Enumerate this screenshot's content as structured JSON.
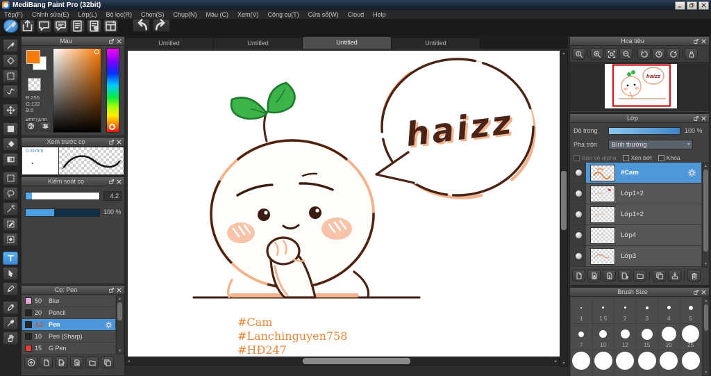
{
  "window": {
    "title": "MediBang Paint Pro (32bit)",
    "controls": [
      {
        "name": "minimize-button",
        "icon": "min"
      },
      {
        "name": "restore-button",
        "icon": "restore"
      },
      {
        "name": "close-button",
        "icon": "closewin"
      }
    ]
  },
  "menu": {
    "items": [
      "Tệp(F)",
      "Chỉnh sửa(E)",
      "Lớp(L)",
      "Bộ lọc(R)",
      "Chọn(S)",
      "Chụp(N)",
      "Màu (C)",
      "Xem(V)",
      "Công cụ(T)",
      "Cửa sổ(W)",
      "Cloud",
      "Help"
    ]
  },
  "toolbar": {
    "main": [
      {
        "name": "paint-mode-button",
        "icon": "brush",
        "active": true
      },
      {
        "name": "share-button",
        "icon": "share"
      },
      {
        "name": "comment-button",
        "icon": "chat"
      },
      {
        "name": "comment-list-button",
        "icon": "chat2"
      },
      {
        "name": "document-button",
        "icon": "doc"
      },
      {
        "name": "document-settings-button",
        "icon": "docgear"
      },
      {
        "name": "material-panel-button",
        "icon": "grid"
      }
    ],
    "history": [
      {
        "name": "undo-button",
        "icon": "undo"
      },
      {
        "name": "redo-button",
        "icon": "redo"
      }
    ]
  },
  "tools": {
    "active_index": 13,
    "group_breaks": [
      4,
      5,
      8,
      13,
      16
    ],
    "items": [
      {
        "name": "brush-tool",
        "icon": "brush"
      },
      {
        "name": "eraser-tool",
        "icon": "eraser"
      },
      {
        "name": "marquee-tool",
        "icon": "marquee"
      },
      {
        "name": "polyline-tool",
        "icon": "polyline"
      },
      {
        "name": "move-tool",
        "icon": "move"
      },
      {
        "name": "fill-rect-tool",
        "icon": "fillrect"
      },
      {
        "name": "bucket-tool",
        "icon": "bucket"
      },
      {
        "name": "gradient-tool",
        "icon": "gradient"
      },
      {
        "name": "select-rect-tool",
        "icon": "marquee"
      },
      {
        "name": "lasso-tool",
        "icon": "lasso"
      },
      {
        "name": "magic-wand-tool",
        "icon": "wand"
      },
      {
        "name": "select-pen-tool",
        "icon": "selpen"
      },
      {
        "name": "select-eraser-tool",
        "icon": "seleraser"
      },
      {
        "name": "text-tool",
        "icon": "text"
      },
      {
        "name": "operation-tool",
        "icon": "operation"
      },
      {
        "name": "divide-tool",
        "icon": "pen"
      },
      {
        "name": "stamp-pen-tool",
        "icon": "pen2"
      },
      {
        "name": "eyedropper-tool",
        "icon": "dropper"
      },
      {
        "name": "hand-tool",
        "icon": "hand"
      }
    ]
  },
  "tabs": {
    "active_index": 2,
    "items": [
      "Untitled",
      "Untitled",
      "Untitled",
      "Untitled"
    ]
  },
  "color_panel": {
    "title": "Màu",
    "r": "R:255",
    "g": "G:122",
    "b": "B:0",
    "hex": "#FF7A00",
    "foreground_color": "#FF7A00",
    "buttons": [
      {
        "name": "palette-button",
        "icon": "palette"
      },
      {
        "name": "color-sliders-button",
        "icon": "sliders"
      }
    ]
  },
  "brush_preview": {
    "title": "Xem trước cọ",
    "size_label": "0.31mm"
  },
  "brush_control": {
    "title": "Kiểm soát cọ",
    "size_value": "4.2",
    "opacity_value": "100 %"
  },
  "brush_list": {
    "title": "Cọ: Pen",
    "selected_index": 2,
    "items": [
      {
        "size": "50",
        "name": "Blur",
        "swatch": "#e9a8d8"
      },
      {
        "size": "20",
        "name": "Pencil",
        "swatch": "#262626"
      },
      {
        "size": "4.2",
        "name": "Pen",
        "swatch": "#262626"
      },
      {
        "size": "10",
        "name": "Pen (Sharp)",
        "swatch": "#262626"
      },
      {
        "size": "15",
        "name": "G Pen",
        "swatch": "#e04038"
      }
    ],
    "toolbar": [
      {
        "name": "upload-brush-button",
        "icon": "upload"
      },
      {
        "name": "add-brush-button",
        "icon": "page"
      },
      {
        "name": "add-brush-image-button",
        "icon": "pagedd"
      },
      {
        "name": "add-script-brush-button",
        "icon": "pages"
      },
      {
        "name": "brush-folder-button",
        "icon": "folder"
      },
      {
        "name": "duplicate-brush-button",
        "icon": "dup"
      }
    ]
  },
  "navigator": {
    "title": "Hoa tiêu",
    "buttons": [
      {
        "name": "zoom-reset-button",
        "icon": "zoomorig"
      },
      {
        "name": "zoom-in-button",
        "icon": "zoomin"
      },
      {
        "name": "fit-window-button",
        "icon": "fit"
      },
      {
        "name": "zoom-out-button",
        "icon": "zoomout"
      },
      {
        "name": "rotate-ccw-button",
        "icon": "rotccw"
      },
      {
        "name": "rotate-reset-button",
        "icon": "rotreset"
      },
      {
        "name": "rotate-cw-button",
        "icon": "rotcw"
      },
      {
        "name": "unlock-button",
        "icon": "lock"
      }
    ],
    "separators_after": [
      0,
      3,
      6
    ]
  },
  "layers_panel": {
    "title": "Lớp",
    "opacity_label": "Độ trong",
    "opacity_value": "100 %",
    "blend_label": "Pha trộn",
    "blend_value": "Bình thường",
    "checkboxes": [
      {
        "label": "Bảo vệ alpha",
        "dim": true
      },
      {
        "label": "Xén bớt",
        "dim": false
      },
      {
        "label": "Khóa",
        "dim": false
      }
    ],
    "selected_index": 0,
    "layers": [
      {
        "name": "#Cam"
      },
      {
        "name": "Lớp1+2"
      },
      {
        "name": "Lớp1+2"
      },
      {
        "name": "Lớp4"
      },
      {
        "name": "Lớp3"
      }
    ],
    "toolbar": [
      {
        "name": "add-layer-button",
        "icon": "page"
      },
      {
        "name": "add-8bit-layer-button",
        "icon": "page8"
      },
      {
        "name": "add-1bit-layer-button",
        "icon": "page1"
      },
      {
        "name": "add-layer-menu-button",
        "icon": "pageplus"
      },
      {
        "name": "layer-folder-button",
        "icon": "folder"
      },
      {
        "name": "duplicate-layer-button",
        "icon": "dup"
      },
      {
        "name": "merge-layer-button",
        "icon": "merge"
      },
      {
        "name": "delete-layer-button",
        "icon": "trash"
      }
    ],
    "toolbar_separators_after": [
      4,
      6
    ]
  },
  "brush_size_panel": {
    "title": "Brush Size",
    "rows": [
      {
        "labels": [
          "1",
          "1.5",
          "2",
          "3",
          "4",
          "5"
        ]
      },
      {
        "labels": [
          "7",
          "10",
          "12",
          "15",
          "20",
          "25"
        ]
      },
      {
        "labels": [
          "",
          "",
          "",
          "",
          "",
          ""
        ]
      }
    ]
  },
  "canvas": {
    "bubble_text": "haizz",
    "hashtags": [
      "#Cam",
      "#Lanchinguyen758",
      "#HĐ247"
    ],
    "accent_colors": {
      "outline_brown": "#4a2314",
      "skin_peach": "#f2b48e",
      "hashtag_orange": "#ee8435",
      "leaf_green": "#3cb44a"
    }
  }
}
